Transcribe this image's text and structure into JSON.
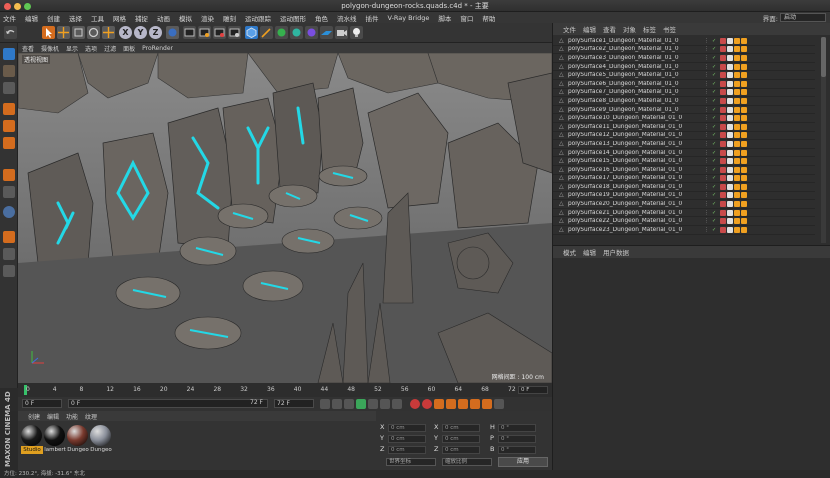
{
  "window": {
    "title": "polygon-dungeon-rocks.quads.c4d * - 主要"
  },
  "menubar": {
    "items": [
      "文件",
      "编辑",
      "创建",
      "选择",
      "工具",
      "网格",
      "捕捉",
      "动画",
      "模拟",
      "渲染",
      "雕刻",
      "运动跟踪",
      "运动图形",
      "角色",
      "流水线",
      "插件",
      "V-Ray Bridge",
      "脚本",
      "窗口",
      "帮助"
    ],
    "layout_label": "界面:",
    "layout_value": "启动"
  },
  "viewport": {
    "menu": [
      "查看",
      "摄像机",
      "显示",
      "选项",
      "过滤",
      "面板",
      "ProRender"
    ],
    "label": "透视视图",
    "grid_label": "网格间距 : 100 cm"
  },
  "timeline": {
    "ticks": [
      "0",
      "4",
      "8",
      "12",
      "16",
      "20",
      "24",
      "28",
      "32",
      "36",
      "40",
      "44",
      "48",
      "52",
      "56",
      "60",
      "64",
      "68",
      "72"
    ],
    "end_label": "0 F"
  },
  "transport": {
    "current_frame": "0 F",
    "min_frame": "0 F",
    "max_frame": "72 F",
    "end_frame": "72 F"
  },
  "materials": {
    "menu": [
      "创建",
      "编辑",
      "功能",
      "纹理"
    ],
    "items": [
      {
        "label": "Studio",
        "color": "#1a1a1a",
        "selected": true
      },
      {
        "label": "lambert",
        "color": "#111111",
        "selected": false
      },
      {
        "label": "Dungeo",
        "color": "#7a3a2e",
        "selected": false
      },
      {
        "label": "Dungeo",
        "color": "#8a8f9a",
        "selected": false
      }
    ]
  },
  "coords": {
    "rows": [
      {
        "a": "X",
        "av": "0 cm",
        "b": "X",
        "bv": "0 cm",
        "c": "H",
        "cv": "0 °"
      },
      {
        "a": "Y",
        "av": "0 cm",
        "b": "Y",
        "bv": "0 cm",
        "c": "P",
        "cv": "0 °"
      },
      {
        "a": "Z",
        "av": "0 cm",
        "b": "Z",
        "bv": "0 cm",
        "c": "B",
        "cv": "0 °"
      }
    ],
    "space": "世界坐标",
    "mode": "缩放比例",
    "apply": "应用"
  },
  "branding": {
    "text": "MAXON CINEMA 4D"
  },
  "status": {
    "text": "方位: 230.2°, 海拔: -31.6° 东北"
  },
  "objects": {
    "menu": [
      "文件",
      "编辑",
      "查看",
      "对象",
      "标签",
      "书签"
    ],
    "items": [
      "polySurface1_Dungeon_Material_01_0",
      "polySurface2_Dungeon_Material_01_0",
      "polySurface3_Dungeon_Material_01_0",
      "polySurface4_Dungeon_Material_01_0",
      "polySurface5_Dungeon_Material_01_0",
      "polySurface6_Dungeon_Material_01_0",
      "polySurface7_Dungeon_Material_01_0",
      "polySurface8_Dungeon_Material_01_0",
      "polySurface9_Dungeon_Material_01_0",
      "polySurface10_Dungeon_Material_01_0",
      "polySurface11_Dungeon_Material_01_0",
      "polySurface12_Dungeon_Material_01_0",
      "polySurface13_Dungeon_Material_01_0",
      "polySurface14_Dungeon_Material_01_0",
      "polySurface15_Dungeon_Material_01_0",
      "polySurface16_Dungeon_Material_01_0",
      "polySurface17_Dungeon_Material_01_0",
      "polySurface18_Dungeon_Material_01_0",
      "polySurface19_Dungeon_Material_01_0",
      "polySurface20_Dungeon_Material_01_0",
      "polySurface21_Dungeon_Material_01_0",
      "polySurface22_Dungeon_Material_01_0",
      "polySurface23_Dungeon_Material_01_0"
    ]
  },
  "attributes": {
    "menu": [
      "模式",
      "编辑",
      "用户数据"
    ]
  },
  "colors": {
    "accent": "#2d9bf0",
    "rune": "#23d8e6",
    "keyframe": "#f0a020"
  }
}
